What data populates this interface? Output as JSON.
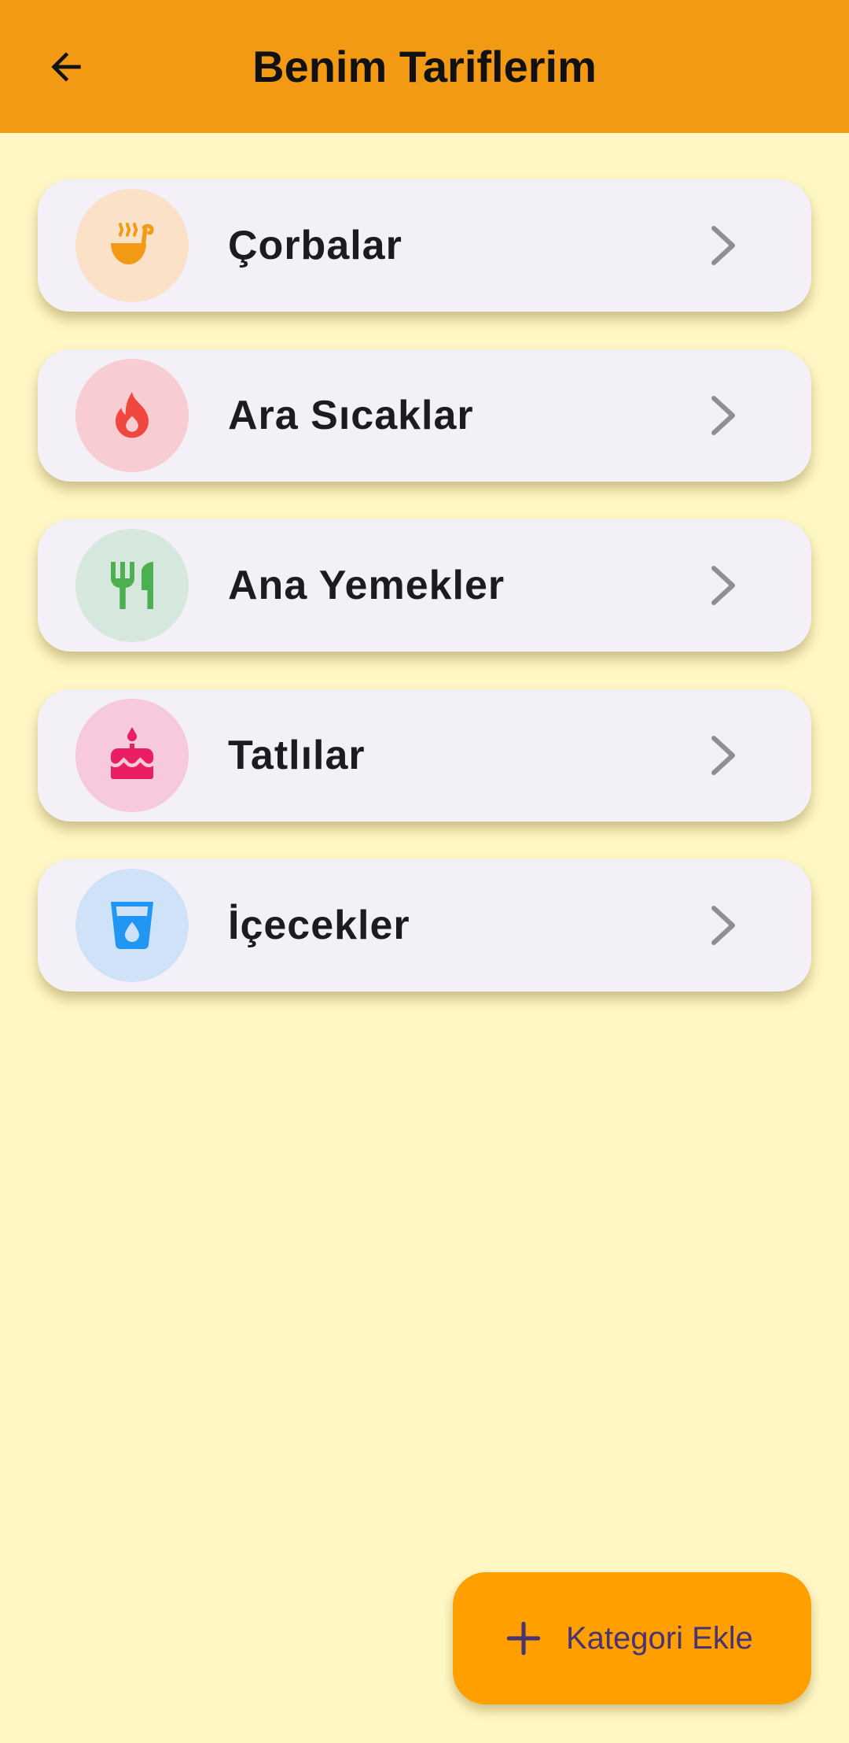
{
  "app_bar": {
    "title": "Benim Tariflerim",
    "back_icon": "arrow-back-icon",
    "background": "#F29A14"
  },
  "categories": [
    {
      "label": "Çorbalar",
      "icon": "soup-ladle-icon",
      "icon_color": "#F29A14",
      "circle_color": "#FAE1C7"
    },
    {
      "label": "Ara Sıcaklar",
      "icon": "fire-icon",
      "icon_color": "#F0473E",
      "circle_color": "#F7CDD2"
    },
    {
      "label": "Ana Yemekler",
      "icon": "fork-knife-icon",
      "icon_color": "#4CAF50",
      "circle_color": "#D6E7DD"
    },
    {
      "label": "Tatlılar",
      "icon": "cake-icon",
      "icon_color": "#E91E63",
      "circle_color": "#F6C9DC"
    },
    {
      "label": "İçecekler",
      "icon": "drink-glass-icon",
      "icon_color": "#2196F3",
      "circle_color": "#CFE2F8"
    }
  ],
  "fab": {
    "label": "Kategori Ekle",
    "icon": "plus-icon",
    "background": "#FFA000",
    "text_color": "#4A3372"
  },
  "colors": {
    "page_background": "#FFF8C5",
    "card_background": "#F4F0F7",
    "chevron": "#8E8E93"
  }
}
